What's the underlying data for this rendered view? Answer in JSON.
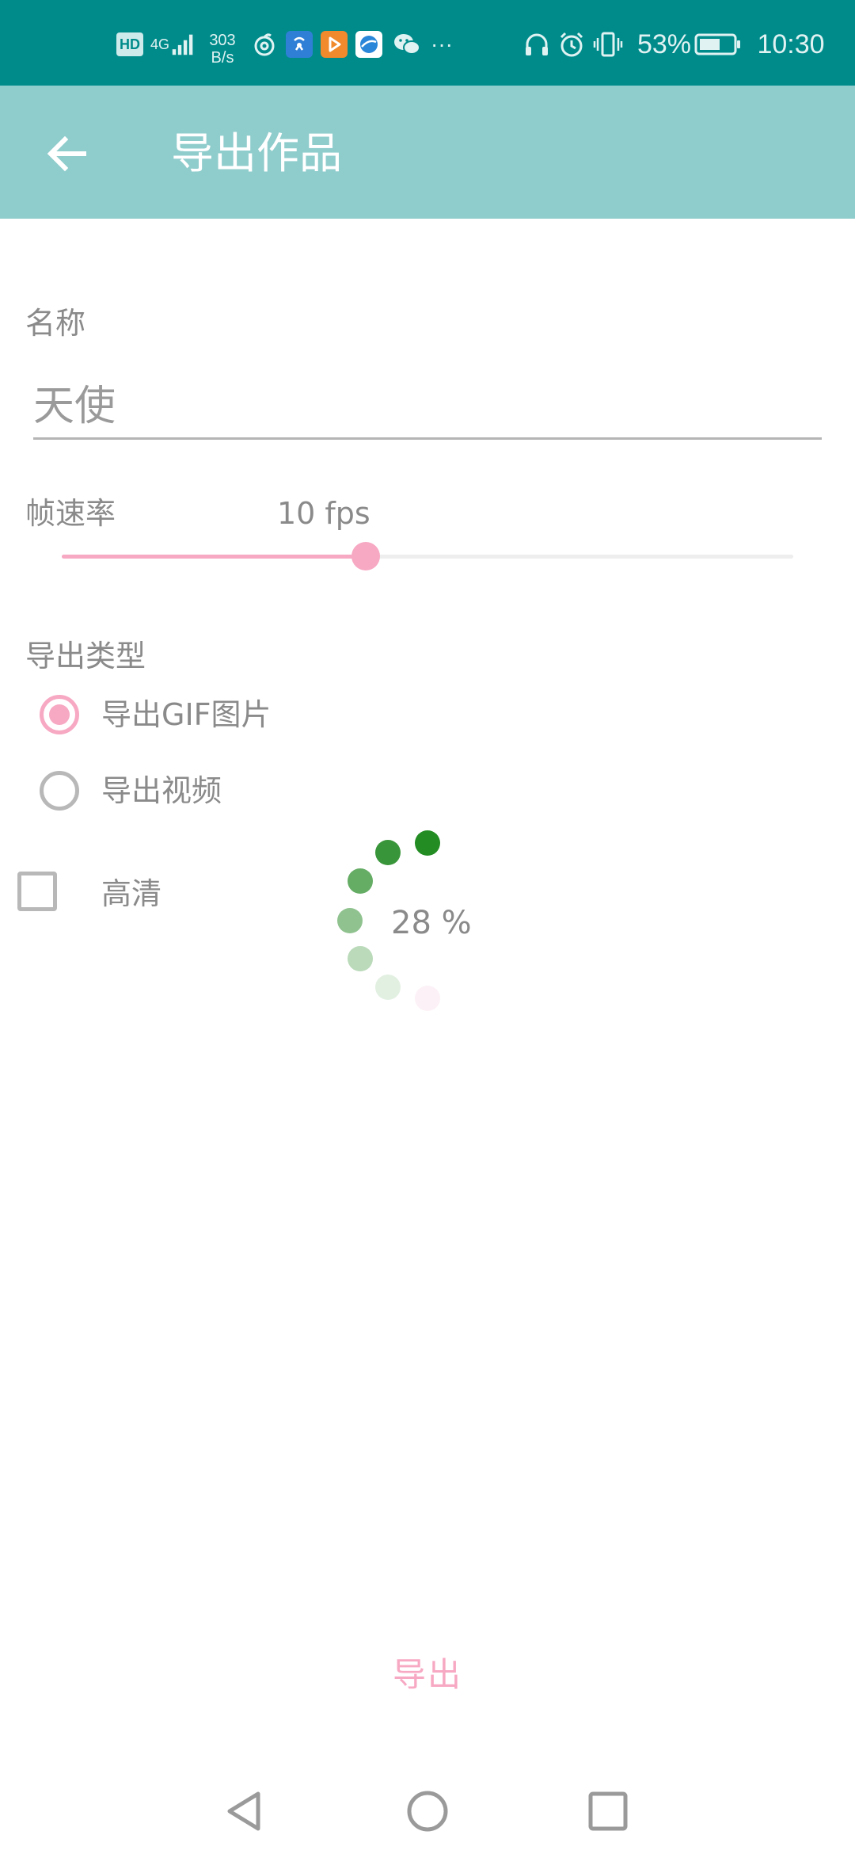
{
  "status_bar": {
    "network_speed_value": "303",
    "network_speed_unit": "B/s",
    "signal_type": "4G",
    "hd_badge": "HD",
    "more_indicator": "···",
    "battery_percent": "53%",
    "time": "10:30"
  },
  "app_bar": {
    "title": "导出作品",
    "back_icon": "arrow-left-icon"
  },
  "form": {
    "name_label": "名称",
    "name_value": "天使",
    "frame_rate_label": "帧速率",
    "frame_rate_value": "10 fps",
    "frame_rate_fraction": 0.416,
    "export_type_label": "导出类型",
    "export_options": [
      {
        "label": "导出GIF图片",
        "checked": true
      },
      {
        "label": "导出视频",
        "checked": false
      }
    ],
    "hd_label": "高清",
    "hd_checked": false
  },
  "progress": {
    "text": "28 %"
  },
  "actions": {
    "export_label": "导出"
  },
  "colors": {
    "status_bar": "#008b8b",
    "app_bar": "#8fcccc",
    "accent_pink": "#f7a8c2",
    "spinner_green": "#238c23"
  }
}
